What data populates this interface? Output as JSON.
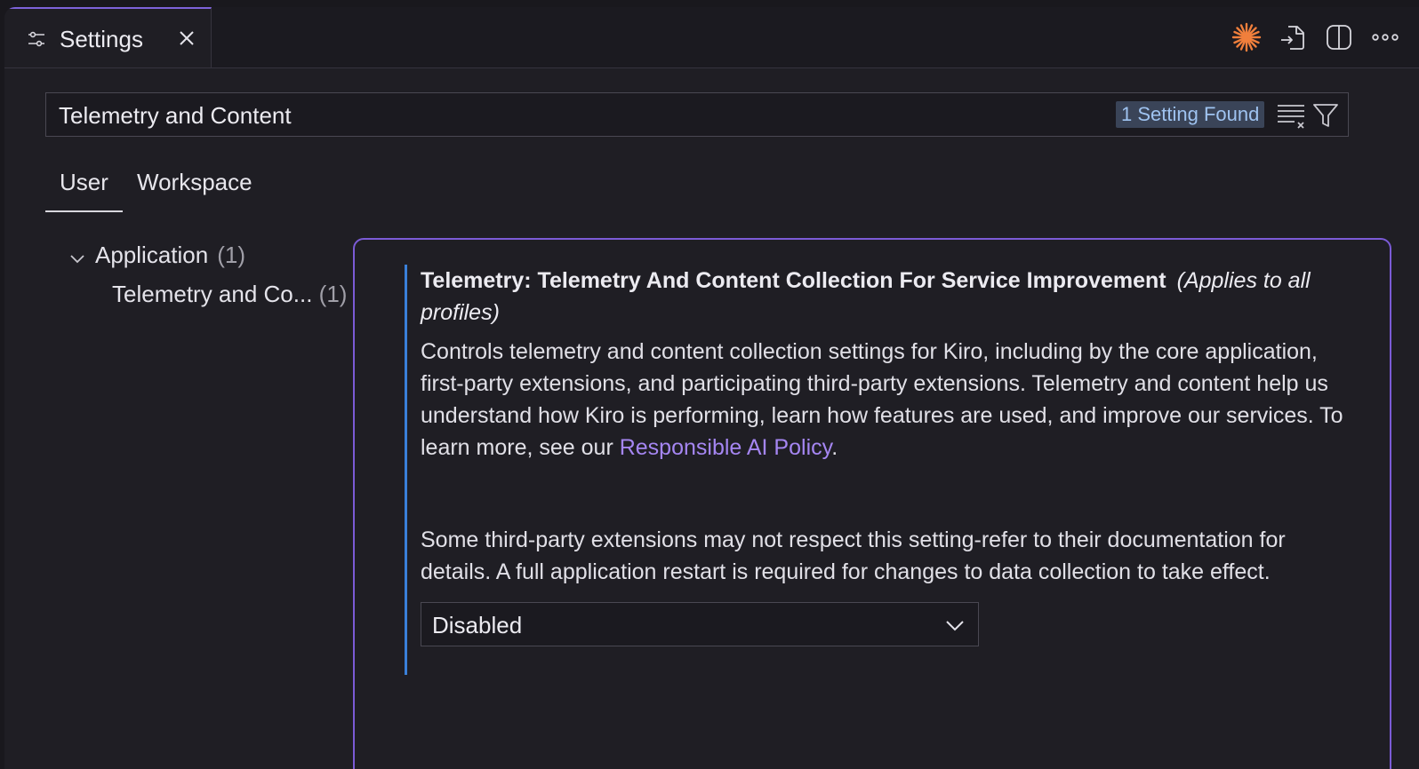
{
  "tab": {
    "title": "Settings",
    "icon": "settings-sliders-icon",
    "close_icon": "close-icon"
  },
  "editor_actions": [
    "kiro-spark-icon",
    "open-settings-json-icon",
    "split-editor-icon",
    "more-actions-icon"
  ],
  "search": {
    "value": "Telemetry and Content",
    "result_badge": "1 Setting Found"
  },
  "scope_tabs": {
    "user": "User",
    "workspace": "Workspace",
    "active": "User"
  },
  "toc": {
    "group": {
      "label": "Application",
      "count": "(1)"
    },
    "item": {
      "label": "Telemetry and Co...",
      "count": "(1)"
    }
  },
  "setting": {
    "category": "Telemetry: ",
    "name": "Telemetry And Content Collection For Service Improvement",
    "scope_note": "(Applies to all profiles)",
    "desc_1": "Controls telemetry and content collection settings for Kiro, including by the core application, first-party extensions, and participating third-party extensions. Telemetry and content help us understand how Kiro is performing, learn how features are used, and improve our services. To learn more, see our ",
    "link": "Responsible AI Policy",
    "desc_1_end": ".",
    "desc_2": "Some third-party extensions may not respect this setting-refer to their documentation for details. A full application restart is required for changes to data collection to take effect.",
    "value": "Disabled"
  },
  "colors": {
    "accent": "#7b5bd6",
    "link": "#a586f2",
    "focus_bar": "#3a80d9",
    "badge_bg": "#3a4458",
    "spark": "#f07f3c"
  }
}
